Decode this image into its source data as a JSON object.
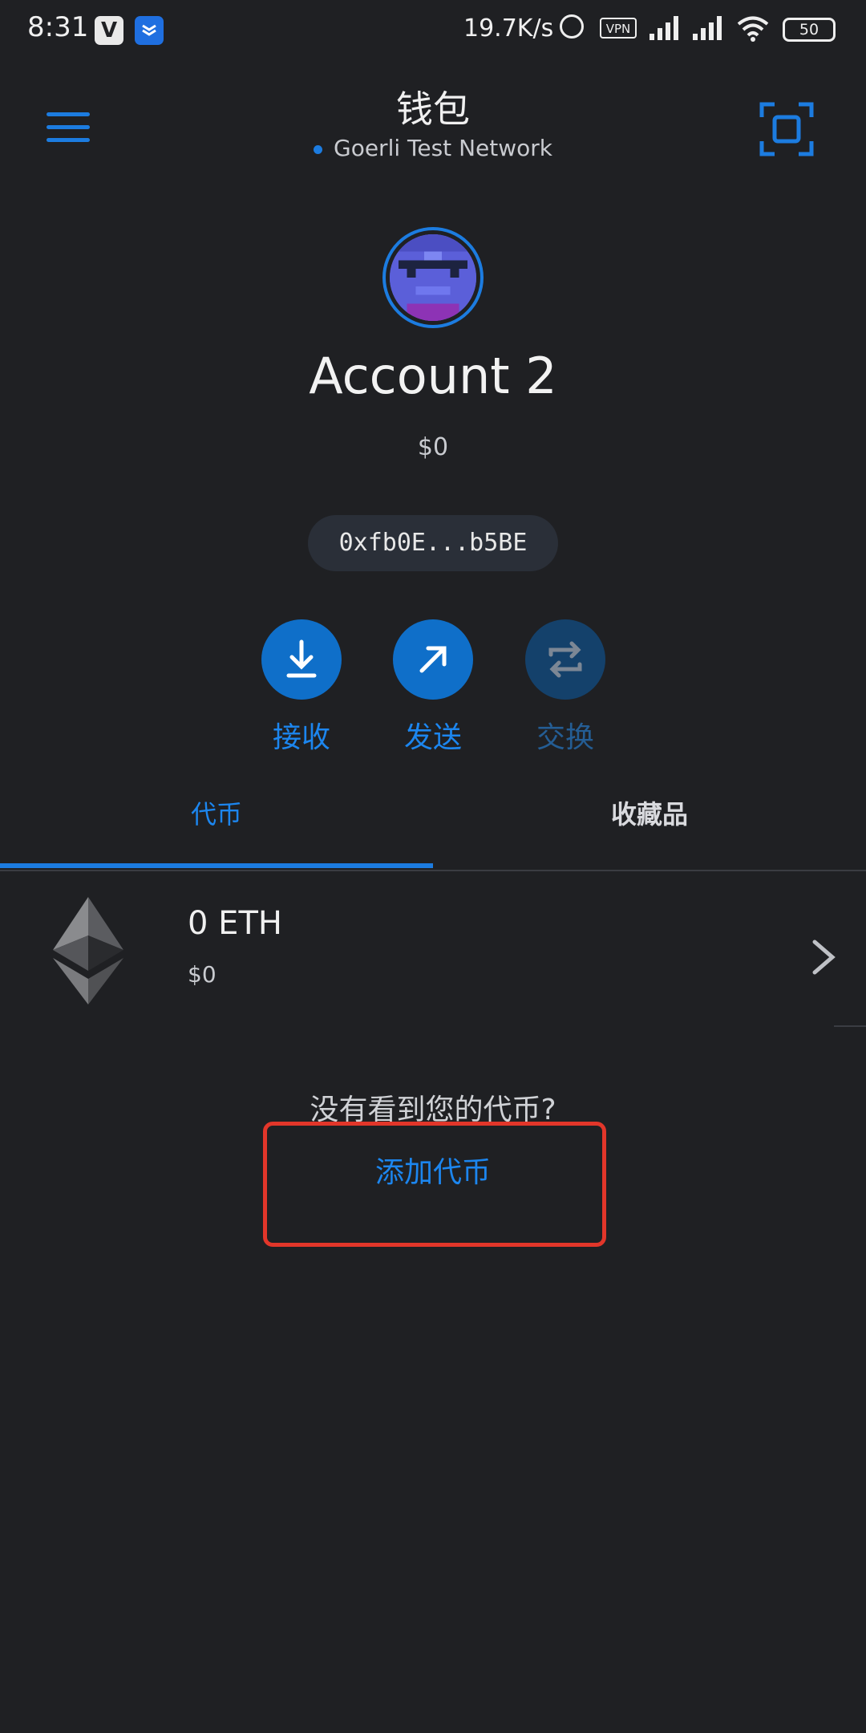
{
  "status_bar": {
    "time": "8:31",
    "app1_letter": "V",
    "net_speed": "19.7K/s",
    "vpn": "VPN",
    "battery": "50"
  },
  "header": {
    "title": "钱包",
    "network": "Goerli Test Network"
  },
  "account": {
    "name": "Account 2",
    "balance": "$0",
    "address": "0xfb0E...b5BE"
  },
  "actions": [
    {
      "label": "接收",
      "icon": "download-icon",
      "enabled": true
    },
    {
      "label": "发送",
      "icon": "arrow-up-right-icon",
      "enabled": true
    },
    {
      "label": "交换",
      "icon": "swap-icon",
      "enabled": false
    }
  ],
  "tabs": [
    {
      "label": "代币",
      "active": true
    },
    {
      "label": "收藏品",
      "active": false
    }
  ],
  "tokens": [
    {
      "amount": "0 ETH",
      "fiat": "$0",
      "icon": "ethereum-icon"
    }
  ],
  "prompt": {
    "question": "没有看到您的代币?",
    "link": "添加代币"
  },
  "colors": {
    "background": "#1f2023",
    "accent": "#1c7ce0",
    "highlight": "#e2362a"
  }
}
